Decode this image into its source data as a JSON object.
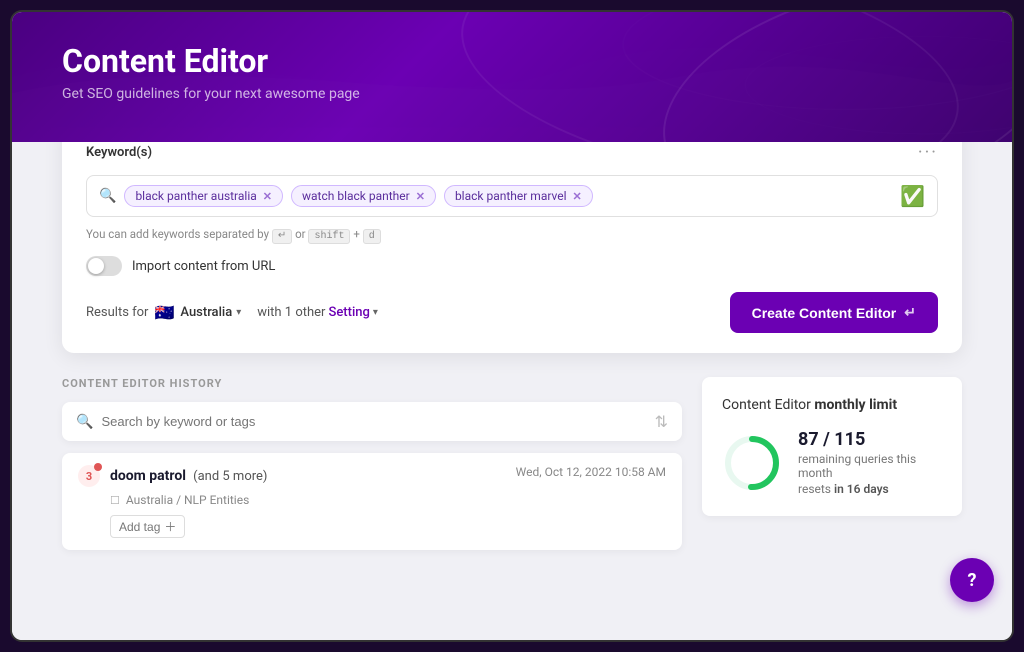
{
  "app": {
    "title": "Content Editor",
    "subtitle": "Get SEO guidelines for your next awesome page"
  },
  "keywords_card": {
    "label": "Keyword(s)",
    "tags": [
      {
        "text": "black panther australia",
        "id": "tag-1"
      },
      {
        "text": "watch black panther",
        "id": "tag-2"
      },
      {
        "text": "black panther marvel",
        "id": "tag-3"
      }
    ],
    "hint": "You can add keywords separated by",
    "hint_separator": "or",
    "hint_key1": "↵",
    "hint_key2": "shift",
    "hint_key3": "d"
  },
  "import_toggle": {
    "label": "Import content from URL"
  },
  "results_row": {
    "results_for": "Results for",
    "country": "Australia",
    "with_other": "with 1 other",
    "setting": "Setting"
  },
  "create_btn": {
    "label": "Create Content Editor",
    "enter_symbol": "↵"
  },
  "history": {
    "section_label": "CONTENT EDITOR HISTORY",
    "search_placeholder": "Search by keyword or tags",
    "item": {
      "badge": "3",
      "keyword": "doom patrol",
      "more": "(and 5 more)",
      "date": "Wed, Oct 12, 2022 10:58 AM",
      "meta": "Australia / NLP Entities",
      "add_tag": "Add tag"
    }
  },
  "limit": {
    "title_prefix": "Content Editor ",
    "title_bold": "monthly limit",
    "used": 87,
    "total": 115,
    "remaining_text": "remaining queries this month",
    "resets_text": "resets",
    "resets_bold": "in 16 days"
  },
  "help_btn": "?",
  "colors": {
    "purple_main": "#6b00b3",
    "green_check": "#22c55e",
    "donut_fill": "#22c55e",
    "donut_bg": "#e8f8f0"
  }
}
